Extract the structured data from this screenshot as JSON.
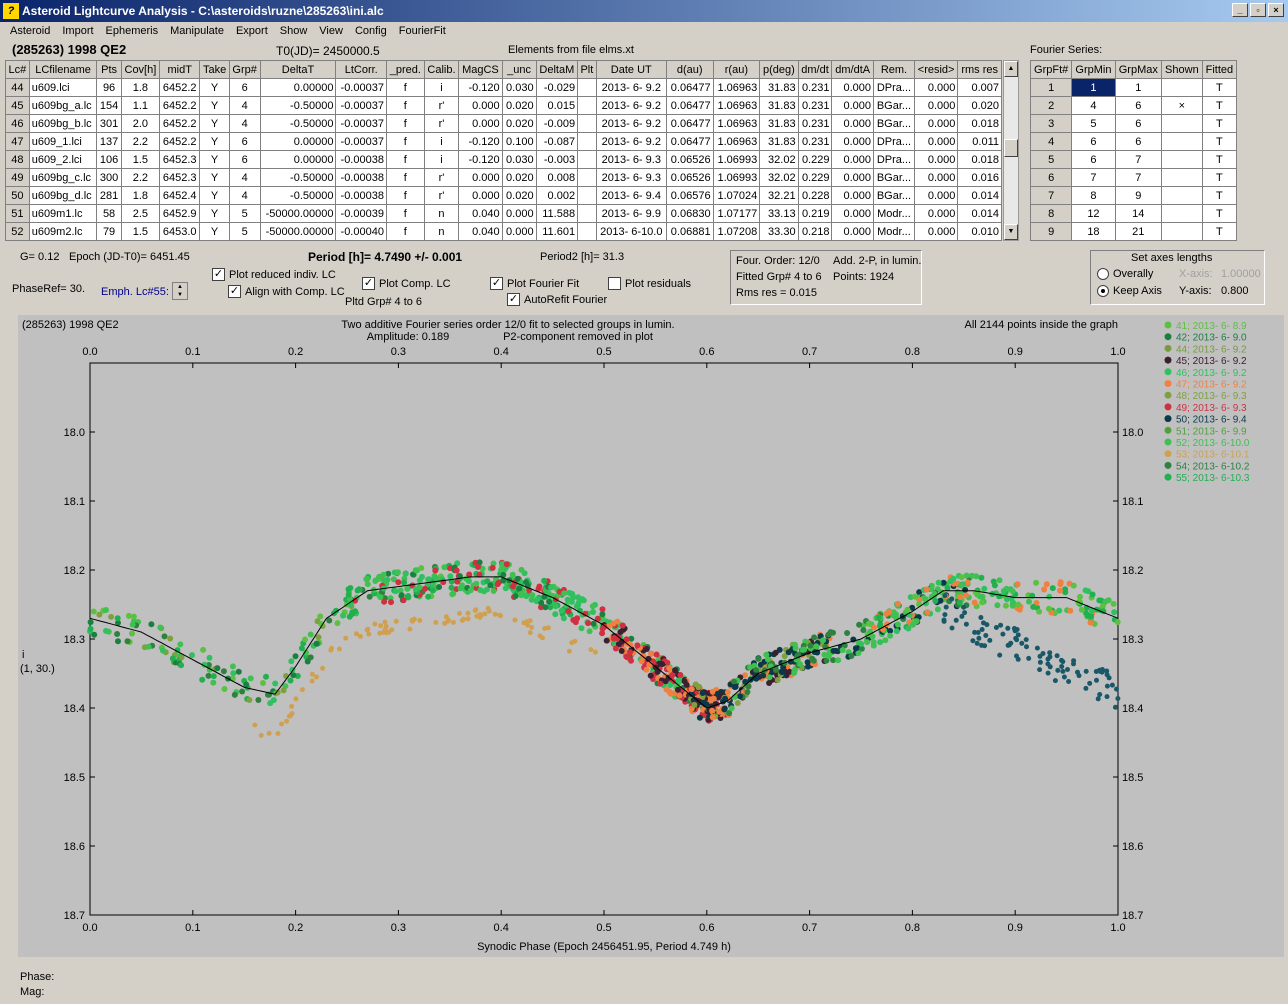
{
  "title": "Asteroid Lightcurve Analysis - C:\\asteroids\\ruzne\\285263\\ini.alc",
  "window_buttons": [
    "_",
    "▫",
    "×"
  ],
  "menu": [
    "Asteroid",
    "Import",
    "Ephemeris",
    "Manipulate",
    "Export",
    "Show",
    "View",
    "Config",
    "FourierFit"
  ],
  "header": {
    "object": "(285263) 1998 QE2",
    "t0": "T0(JD)= 2450000.5",
    "elements": "Elements from file elms.xt",
    "fourier_label": "Fourier Series:"
  },
  "lc_table": {
    "columns": [
      "Lc#",
      "LCfilename",
      "Pts",
      "Cov[h]",
      "midT",
      "Take",
      "Grp#",
      "DeltaT",
      "LtCorr.",
      "_pred.",
      "Calib.",
      "MagCS",
      "_unc",
      "DeltaM",
      "Plt",
      "Date UT",
      "d(au)",
      "r(au)",
      "p(deg)",
      "dm/dt",
      "dm/dtA",
      "Rem.",
      "<resid>",
      "rms res"
    ],
    "rows": [
      [
        "44",
        "u609.lci",
        "96",
        "1.8",
        "6452.2",
        "Y",
        "6",
        "0.00000",
        "-0.00037",
        "f",
        "i",
        "-0.120",
        "0.030",
        "-0.029",
        "",
        "2013- 6- 9.2",
        "0.06477",
        "1.06963",
        "31.83",
        "0.231",
        "0.000",
        "DPra...",
        "0.000",
        "0.007"
      ],
      [
        "45",
        "u609bg_a.lc",
        "154",
        "1.1",
        "6452.2",
        "Y",
        "4",
        "-0.50000",
        "-0.00037",
        "f",
        "r'",
        "0.000",
        "0.020",
        "0.015",
        "",
        "2013- 6- 9.2",
        "0.06477",
        "1.06963",
        "31.83",
        "0.231",
        "0.000",
        "BGar...",
        "0.000",
        "0.020"
      ],
      [
        "46",
        "u609bg_b.lc",
        "301",
        "2.0",
        "6452.2",
        "Y",
        "4",
        "-0.50000",
        "-0.00037",
        "f",
        "r'",
        "0.000",
        "0.020",
        "-0.009",
        "",
        "2013- 6- 9.2",
        "0.06477",
        "1.06963",
        "31.83",
        "0.231",
        "0.000",
        "BGar...",
        "0.000",
        "0.018"
      ],
      [
        "47",
        "u609_1.lci",
        "137",
        "2.2",
        "6452.2",
        "Y",
        "6",
        "0.00000",
        "-0.00037",
        "f",
        "i",
        "-0.120",
        "0.100",
        "-0.087",
        "",
        "2013- 6- 9.2",
        "0.06477",
        "1.06963",
        "31.83",
        "0.231",
        "0.000",
        "DPra...",
        "0.000",
        "0.011"
      ],
      [
        "48",
        "u609_2.lci",
        "106",
        "1.5",
        "6452.3",
        "Y",
        "6",
        "0.00000",
        "-0.00038",
        "f",
        "i",
        "-0.120",
        "0.030",
        "-0.003",
        "",
        "2013- 6- 9.3",
        "0.06526",
        "1.06993",
        "32.02",
        "0.229",
        "0.000",
        "DPra...",
        "0.000",
        "0.018"
      ],
      [
        "49",
        "u609bg_c.lc",
        "300",
        "2.2",
        "6452.3",
        "Y",
        "4",
        "-0.50000",
        "-0.00038",
        "f",
        "r'",
        "0.000",
        "0.020",
        "0.008",
        "",
        "2013- 6- 9.3",
        "0.06526",
        "1.06993",
        "32.02",
        "0.229",
        "0.000",
        "BGar...",
        "0.000",
        "0.016"
      ],
      [
        "50",
        "u609bg_d.lc",
        "281",
        "1.8",
        "6452.4",
        "Y",
        "4",
        "-0.50000",
        "-0.00038",
        "f",
        "r'",
        "0.000",
        "0.020",
        "0.002",
        "",
        "2013- 6- 9.4",
        "0.06576",
        "1.07024",
        "32.21",
        "0.228",
        "0.000",
        "BGar...",
        "0.000",
        "0.014"
      ],
      [
        "51",
        "u609m1.lc",
        "58",
        "2.5",
        "6452.9",
        "Y",
        "5",
        "-50000.00000",
        "-0.00039",
        "f",
        "n",
        "0.040",
        "0.000",
        "11.588",
        "",
        "2013- 6- 9.9",
        "0.06830",
        "1.07177",
        "33.13",
        "0.219",
        "0.000",
        "Modr...",
        "0.000",
        "0.014"
      ],
      [
        "52",
        "u609m2.lc",
        "79",
        "1.5",
        "6453.0",
        "Y",
        "5",
        "-50000.00000",
        "-0.00040",
        "f",
        "n",
        "0.040",
        "0.000",
        "11.601",
        "",
        "2013- 6-10.0",
        "0.06881",
        "1.07208",
        "33.30",
        "0.218",
        "0.000",
        "Modr...",
        "0.000",
        "0.010"
      ]
    ]
  },
  "fourier_table": {
    "columns": [
      "GrpFt#",
      "GrpMin",
      "GrpMax",
      "Shown",
      "Fitted"
    ],
    "rows": [
      [
        "1",
        "1",
        "1",
        "",
        "T"
      ],
      [
        "2",
        "4",
        "6",
        "×",
        "T"
      ],
      [
        "3",
        "5",
        "6",
        "",
        "T"
      ],
      [
        "4",
        "6",
        "6",
        "",
        "T"
      ],
      [
        "5",
        "6",
        "7",
        "",
        "T"
      ],
      [
        "6",
        "7",
        "7",
        "",
        "T"
      ],
      [
        "7",
        "8",
        "9",
        "",
        "T"
      ],
      [
        "8",
        "12",
        "14",
        "",
        "T"
      ],
      [
        "9",
        "18",
        "21",
        "",
        "T"
      ]
    ]
  },
  "controls": {
    "g": "G= 0.12",
    "epoch": "Epoch (JD-T0)= 6451.45",
    "period": "Period [h]= 4.7490 +/- 0.001",
    "period2": "Period2 [h]= 31.3",
    "phaseref": "PhaseRef= 30.",
    "emph": "Emph. Lc#55:",
    "plot_reduced": "Plot reduced indiv. LC",
    "align": "Align with Comp. LC",
    "plot_comp": "Plot Comp. LC",
    "pltd_grp": "Pltd Grp#  4   to   6",
    "plot_fourier": "Plot Fourier Fit",
    "autorefit": "AutoRefit Fourier",
    "plot_resid": "Plot residuals",
    "info": [
      "Four. Order: 12/0",
      "Add. 2-P, in lumin.",
      "Fitted Grp# 4 to 6",
      "Points: 1924",
      "Rms res     = 0.015"
    ],
    "axes_title": "Set axes lengths",
    "overally": "Overally",
    "keep_axis": "Keep Axis",
    "xaxis_label": "X-axis:",
    "xaxis_val": "1.00000",
    "yaxis_label": "Y-axis:",
    "yaxis_val": "0.800"
  },
  "status": {
    "phase": "Phase:",
    "mag": "Mag:"
  },
  "chart_data": {
    "type": "scatter",
    "title": "Two additive Fourier series order 12/0 fit to selected groups in lumin.",
    "subtitle_left": "Amplitude: 0.189",
    "subtitle_right": "P2-component removed in plot",
    "corner_left": "(285263) 1998 QE2",
    "corner_right": "All 2144 points inside the graph",
    "xlabel": "Synodic Phase (Epoch 2456451.95, Period 4.749 h)",
    "ylabel": "i",
    "ylabel2": "(1, 30.)",
    "xlim": [
      0,
      1
    ],
    "ylim": [
      18.7,
      17.9
    ],
    "xticks": [
      "0.0",
      "0.1",
      "0.2",
      "0.3",
      "0.4",
      "0.5",
      "0.6",
      "0.7",
      "0.8",
      "0.9",
      "1.0"
    ],
    "yticks": [
      "18.0",
      "18.1",
      "18.2",
      "18.3",
      "18.4",
      "18.5",
      "18.6",
      "18.7"
    ],
    "fit": {
      "x": [
        0,
        0.05,
        0.1,
        0.15,
        0.18,
        0.2,
        0.23,
        0.27,
        0.32,
        0.37,
        0.4,
        0.45,
        0.5,
        0.55,
        0.6,
        0.62,
        0.65,
        0.7,
        0.75,
        0.8,
        0.83,
        0.86,
        0.9,
        0.95,
        1.0
      ],
      "y": [
        18.27,
        18.29,
        18.33,
        18.37,
        18.38,
        18.34,
        18.27,
        18.23,
        18.22,
        18.21,
        18.21,
        18.24,
        18.28,
        18.34,
        18.4,
        18.39,
        18.35,
        18.32,
        18.3,
        18.26,
        18.23,
        18.23,
        18.24,
        18.24,
        18.27
      ]
    },
    "legend": [
      {
        "name": "41; 2013- 6- 8.9",
        "color": "#5cc040"
      },
      {
        "name": "42; 2013- 6- 9.0",
        "color": "#1a8040"
      },
      {
        "name": "44; 2013- 6- 9.2",
        "color": "#7a9a40"
      },
      {
        "name": "45; 2013- 6- 9.2",
        "color": "#3a2030"
      },
      {
        "name": "46; 2013- 6- 9.2",
        "color": "#30c060"
      },
      {
        "name": "47; 2013- 6- 9.2",
        "color": "#f08040"
      },
      {
        "name": "48; 2013- 6- 9.3",
        "color": "#80a040"
      },
      {
        "name": "49; 2013- 6- 9.3",
        "color": "#d03040"
      },
      {
        "name": "50; 2013- 6- 9.4",
        "color": "#0a3a48"
      },
      {
        "name": "51; 2013- 6- 9.9",
        "color": "#50a040"
      },
      {
        "name": "52; 2013- 6-10.0",
        "color": "#40c050"
      },
      {
        "name": "53; 2013- 6-10.1",
        "color": "#d0a050"
      },
      {
        "name": "54; 2013- 6-10.2",
        "color": "#308040"
      },
      {
        "name": "55; 2013- 6-10.3",
        "color": "#20b050"
      }
    ]
  }
}
